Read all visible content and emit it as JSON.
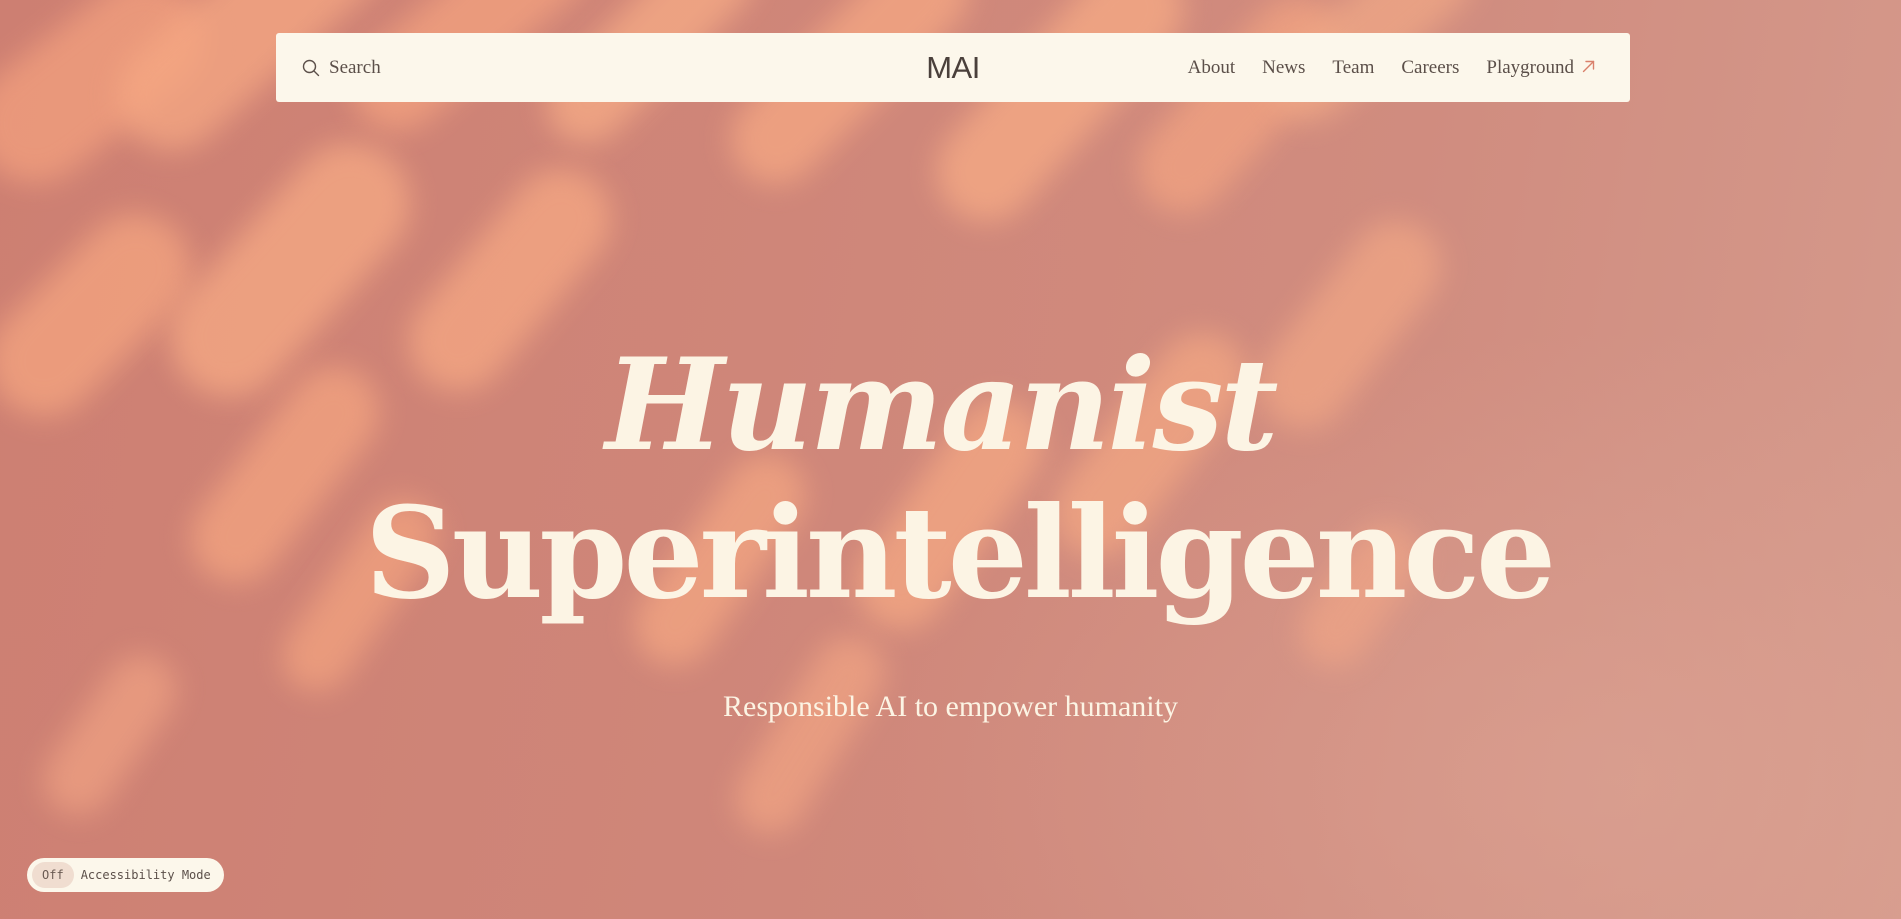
{
  "header": {
    "search_label": "Search",
    "search_icon": "search-icon",
    "logo": "MAI",
    "nav": [
      {
        "label": "About"
      },
      {
        "label": "News"
      },
      {
        "label": "Team"
      },
      {
        "label": "Careers"
      },
      {
        "label": "Playground",
        "icon": "arrow-up-right-icon"
      }
    ]
  },
  "hero": {
    "line1": "Humanist",
    "line2": "Superintelligence",
    "tagline": "Responsible AI to empower humanity"
  },
  "accessibility": {
    "state": "Off",
    "label": "Accessibility Mode"
  },
  "colors": {
    "background": "#cf8477",
    "highlight": "#ffa57f",
    "nav_background": "#fcf7eb",
    "hero_text": "#fcf4e4",
    "arrow_accent": "#d9806b"
  }
}
